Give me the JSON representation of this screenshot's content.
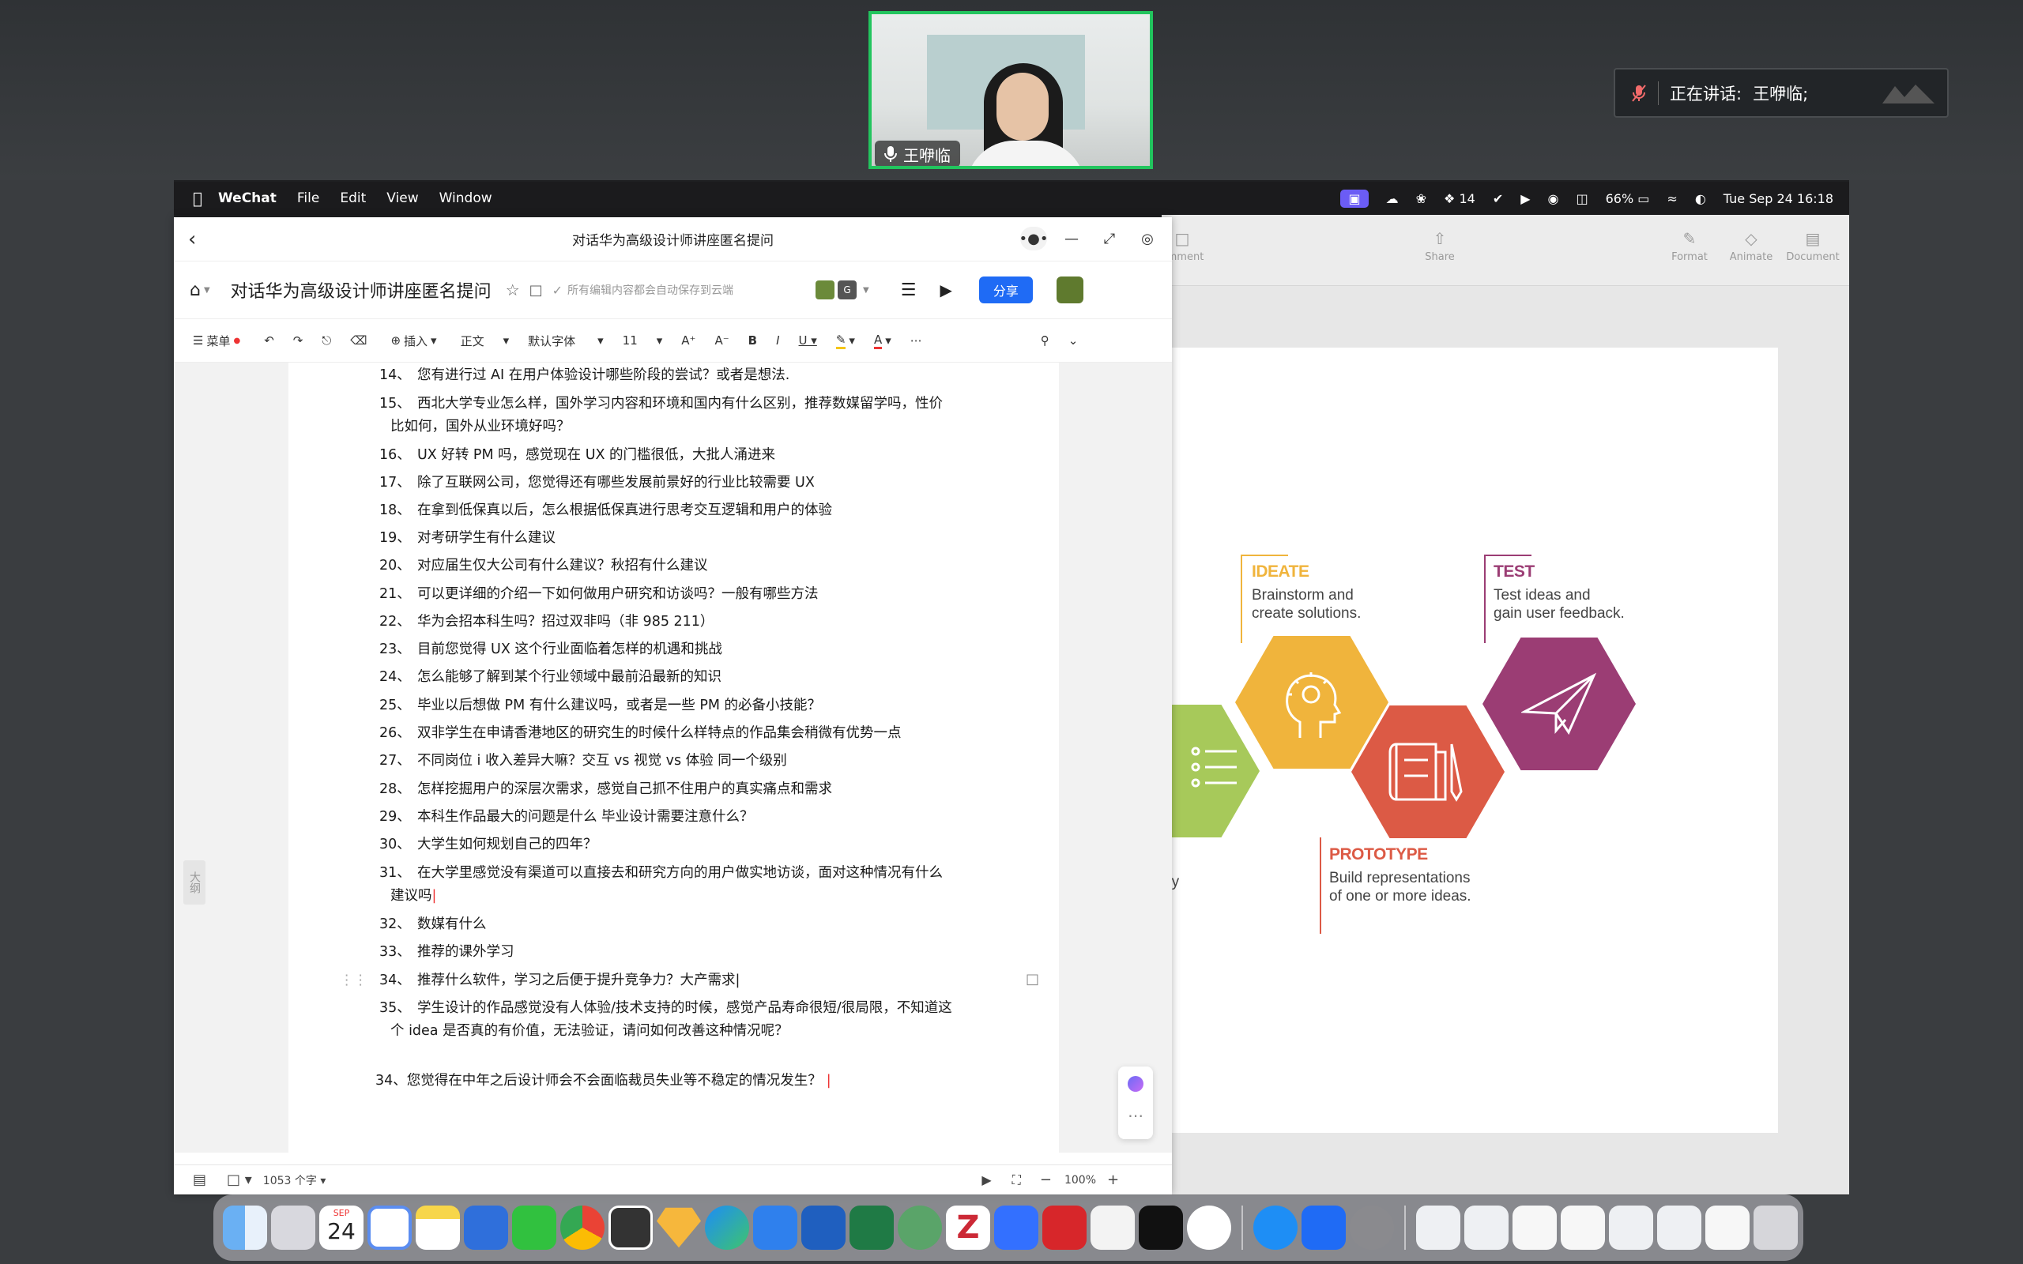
{
  "meeting": {
    "participant_name": "王咿临",
    "speaking_label": "正在讲话:",
    "speaking_name": "王咿临;"
  },
  "menubar": {
    "app": "WeChat",
    "items": [
      "File",
      "Edit",
      "View",
      "Window"
    ],
    "notification_count": "14",
    "battery": "66%",
    "datetime": "Tue Sep 24  16:18"
  },
  "keynote": {
    "toolbar": [
      "omment",
      "Share",
      "Format",
      "Animate",
      "Document"
    ],
    "stages": {
      "ideate": {
        "title": "IDEATE",
        "desc1": "Brainstorm and",
        "desc2": "create solutions."
      },
      "test": {
        "title": "TEST",
        "desc1": "Test ideas and",
        "desc2": "gain user feedback."
      },
      "prototype": {
        "title": "PROTOTYPE",
        "desc1": "Build representations",
        "desc2": "of one or more ideas."
      },
      "partial": "ey"
    },
    "colors": {
      "ideate": "#f0b43c",
      "test": "#9b3d74",
      "prototype": "#dc5a45",
      "define": "#a7c95a"
    }
  },
  "doc": {
    "window_title": "对话华为高级设计师讲座匿名提问",
    "title": "对话华为高级设计师讲座匿名提问",
    "save_status": "所有编辑内容都会自动保存到云端",
    "share_label": "分享",
    "toolbar": {
      "menu": "菜单",
      "insert": "插入",
      "style": "正文",
      "font": "默认字体",
      "size": "11"
    },
    "outline_label": "大纲",
    "questions": [
      {
        "n": "14、",
        "text": "您有进行过 AI 在用户体验设计哪些阶段的尝试？或者是想法."
      },
      {
        "n": "15、",
        "text": "西北大学专业怎么样，国外学习内容和环境和国内有什么区别，推荐数媒留学吗，性价",
        "cont": "比如何，国外从业环境好吗？"
      },
      {
        "n": "16、",
        "text": "UX 好转 PM 吗，感觉现在 UX 的门槛很低，大批人涌进来"
      },
      {
        "n": "17、",
        "text": "除了互联网公司，您觉得还有哪些发展前景好的行业比较需要 UX"
      },
      {
        "n": "18、",
        "text": "在拿到低保真以后，怎么根据低保真进行思考交互逻辑和用户的体验"
      },
      {
        "n": "19、",
        "text": "对考研学生有什么建议"
      },
      {
        "n": "20、",
        "text": "对应届生仅大公司有什么建议？秋招有什么建议"
      },
      {
        "n": "21、",
        "text": "可以更详细的介绍一下如何做用户研究和访谈吗？一般有哪些方法"
      },
      {
        "n": "22、",
        "text": "华为会招本科生吗？招过双非吗（非 985  211）"
      },
      {
        "n": "23、",
        "text": "目前您觉得 UX 这个行业面临着怎样的机遇和挑战"
      },
      {
        "n": "24、",
        "text": "怎么能够了解到某个行业领域中最前沿最新的知识"
      },
      {
        "n": "25、",
        "text": "毕业以后想做 PM 有什么建议吗，或者是一些 PM 的必备小技能？"
      },
      {
        "n": "26、",
        "text": "双非学生在申请香港地区的研究生的时候什么样特点的作品集会稍微有优势一点"
      },
      {
        "n": "27、",
        "text": "不同岗位 i 收入差异大嘛？交互  vs  视觉  vs  体验  同一个级别"
      },
      {
        "n": "28、",
        "text": "怎样挖掘用户的深层次需求，感觉自己抓不住用户的真实痛点和需求"
      },
      {
        "n": "29、",
        "text": "本科生作品最大的问题是什么  毕业设计需要注意什么？"
      },
      {
        "n": "30、",
        "text": "大学生如何规划自己的四年？"
      },
      {
        "n": "31、",
        "text": "在大学里感觉没有渠道可以直接去和研究方向的用户做实地访谈，面对这种情况有什么",
        "cont": "建议吗"
      },
      {
        "n": "32、",
        "text": "数媒有什么"
      },
      {
        "n": "33、",
        "text": "推荐的课外学习"
      },
      {
        "n": "34、",
        "text": "推荐什么软件，学习之后便于提升竞争力？大产需求"
      },
      {
        "n": "35、",
        "text": "学生设计的作品感觉没有人体验/技术支持的时候，感觉产品寿命很短/很局限，不知道这",
        "cont": "个 idea 是否真的有价值，无法验证，请问如何改善这种情况呢？"
      }
    ],
    "extra_question": "34、您觉得在中年之后设计师会不会面临裁员失业等不稳定的情况发生？",
    "status": {
      "word_count": "1053 个字",
      "zoom": "100%"
    }
  },
  "dock": {
    "calendar_month": "SEP",
    "calendar_day": "24"
  }
}
